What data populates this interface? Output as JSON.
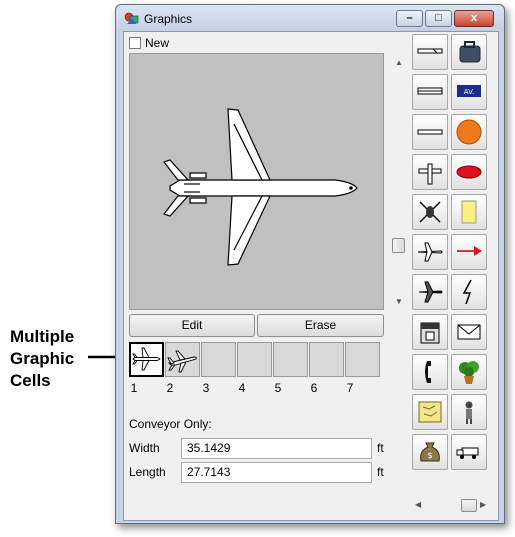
{
  "window": {
    "title": "Graphics"
  },
  "titlebar": {
    "minimize_glyph": "–",
    "maximize_glyph": "□",
    "close_glyph": "x"
  },
  "new_checkbox": {
    "label": "New",
    "checked": false
  },
  "buttons": {
    "edit": "Edit",
    "erase": "Erase"
  },
  "cells": [
    {
      "number": "1",
      "content": "airplane-top-view",
      "selected": true
    },
    {
      "number": "2",
      "content": "airplane-side-view",
      "selected": false
    },
    {
      "number": "3",
      "content": "",
      "selected": false
    },
    {
      "number": "4",
      "content": "",
      "selected": false
    },
    {
      "number": "5",
      "content": "",
      "selected": false
    },
    {
      "number": "6",
      "content": "",
      "selected": false
    },
    {
      "number": "7",
      "content": "",
      "selected": false
    }
  ],
  "conveyor": {
    "heading": "Conveyor Only:",
    "width_label": "Width",
    "width_value": "35.1429",
    "length_label": "Length",
    "length_value": "27.7143",
    "unit": "ft"
  },
  "callout": {
    "line1": "Multiple",
    "line2": "Graphic",
    "line3": "Cells"
  },
  "graphic_library": [
    "conveyor-segment-icon",
    "luggage-icon",
    "tram-icon",
    "av-sign-icon",
    "bar-icon",
    "orange-circle-icon",
    "small-plane-icon",
    "red-disc-icon",
    "helicopter-icon",
    "yellow-note-icon",
    "jet-icon",
    "red-flag-icon",
    "jet-angled-icon",
    "lightning-icon",
    "kiosk-icon",
    "envelope-icon",
    "telephone-icon",
    "potted-plant-icon",
    "map-icon",
    "person-icon",
    "money-bag-icon",
    "truck-icon"
  ],
  "colors": {
    "preview_bg": "#c0c0c0",
    "accent_orange": "#f07a1a",
    "accent_red": "#e01020",
    "note_yellow": "#f8f080"
  }
}
